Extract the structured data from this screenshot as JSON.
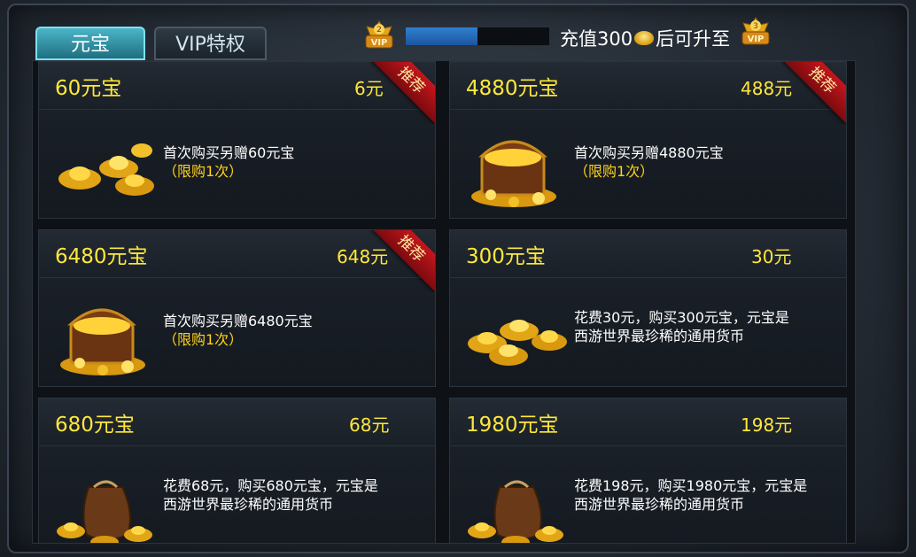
{
  "tabs": [
    {
      "label": "元宝",
      "active": true
    },
    {
      "label": "VIP特权",
      "active": false
    }
  ],
  "vip": {
    "current_level": "2",
    "next_level": "3",
    "badge_text": "VIP",
    "progress": 0.5,
    "prefix": "充值300",
    "suffix": "后可升至"
  },
  "ribbon_label": "推荐",
  "products": [
    {
      "name": "60元宝",
      "price": "6元",
      "line1": "首次购买另赠60元宝",
      "line2": "（限购1次）",
      "recommended": true,
      "art": "ingots-small-icon"
    },
    {
      "name": "4880元宝",
      "price": "488元",
      "line1": "首次购买另赠4880元宝",
      "line2": "（限购1次）",
      "recommended": true,
      "art": "treasure-chest-icon"
    },
    {
      "name": "6480元宝",
      "price": "648元",
      "line1": "首次购买另赠6480元宝",
      "line2": "（限购1次）",
      "recommended": true,
      "art": "treasure-chest-icon"
    },
    {
      "name": "300元宝",
      "price": "30元",
      "line1": "花费30元，购买300元宝，元宝是",
      "line2": "西游世界最珍稀的通用货币",
      "recommended": false,
      "art": "ingots-pile-icon"
    },
    {
      "name": "680元宝",
      "price": "68元",
      "line1": "花费68元，购买680元宝，元宝是",
      "line2": "西游世界最珍稀的通用货币",
      "recommended": false,
      "art": "money-bag-icon"
    },
    {
      "name": "1980元宝",
      "price": "198元",
      "line1": "花费198元，购买1980元宝，元宝是",
      "line2": "西游世界最珍稀的通用货币",
      "recommended": false,
      "art": "money-bag-icon"
    }
  ],
  "colors": {
    "gold_text": "#ffe83a",
    "ribbon_red": "#c4161c",
    "tab_active": "#4ab5c7",
    "progress_blue": "#2f7fd0"
  }
}
